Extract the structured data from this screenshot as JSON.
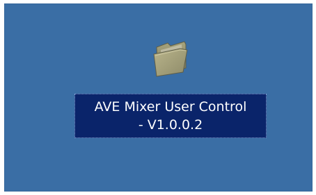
{
  "desktop": {
    "background_color": "#3a6ea5",
    "icon": {
      "type": "folder-icon",
      "label_line1": "AVE Mixer User Control",
      "label_line2": "- V1.0.0.2",
      "selected": true,
      "selection_color": "#0a246a"
    }
  }
}
